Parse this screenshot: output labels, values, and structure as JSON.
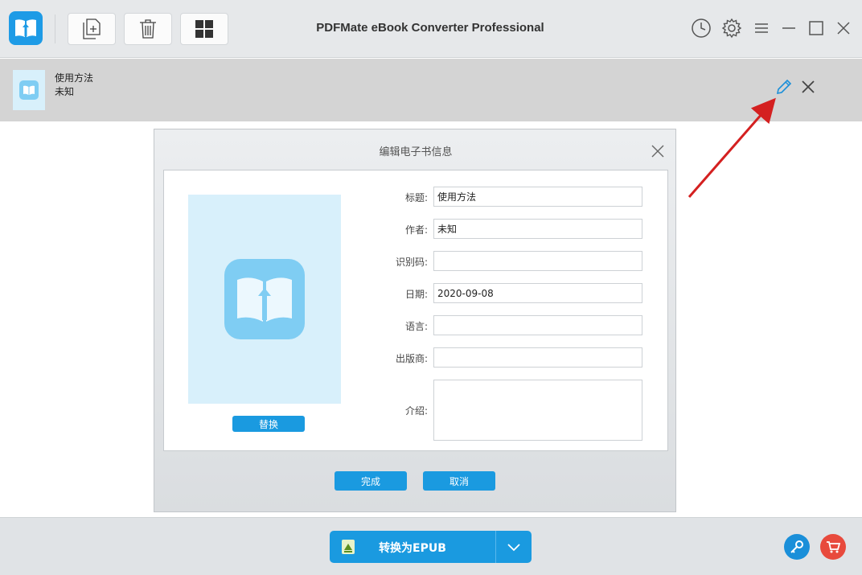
{
  "app": {
    "title": "PDFMate eBook Converter Professional"
  },
  "toolbar": {
    "icons": [
      "add-file-icon",
      "trash-icon",
      "grid-icon"
    ],
    "window_icons": [
      "history-icon",
      "gear-icon",
      "menu-icon",
      "minimize-icon",
      "maximize-icon",
      "close-icon"
    ]
  },
  "file": {
    "title": "使用方法",
    "author": "未知"
  },
  "dialog": {
    "title": "编辑电子书信息",
    "replace_label": "替换",
    "fields": {
      "title_label": "标题:",
      "title_value": "使用方法",
      "author_label": "作者:",
      "author_value": "未知",
      "id_label": "识别码:",
      "id_value": "",
      "date_label": "日期:",
      "date_value": "2020-09-08",
      "language_label": "语言:",
      "language_value": "",
      "publisher_label": "出版商:",
      "publisher_value": "",
      "description_label": "介绍:",
      "description_value": ""
    },
    "ok_label": "完成",
    "cancel_label": "取消"
  },
  "bottom": {
    "convert_label": "转换为EPUB"
  },
  "colors": {
    "accent": "#1a9ae0",
    "cover_bg": "#d8f0fb",
    "cover_icon": "#7fcdf3",
    "buy": "#e84a3d",
    "annotation": "#d42020"
  }
}
